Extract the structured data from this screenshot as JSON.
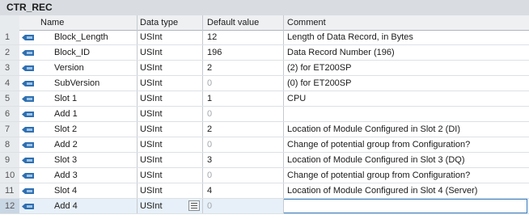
{
  "block": {
    "title": "CTR_REC"
  },
  "columns": {
    "name": "Name",
    "datatype": "Data type",
    "default": "Default value",
    "comment": "Comment"
  },
  "rows": [
    {
      "num": "1",
      "name": "Block_Length",
      "type": "USInt",
      "default": "12",
      "default_muted": false,
      "comment": "Length of Data Record, in Bytes"
    },
    {
      "num": "2",
      "name": "Block_ID",
      "type": "USInt",
      "default": "196",
      "default_muted": false,
      "comment": "Data Record Number (196)"
    },
    {
      "num": "3",
      "name": "Version",
      "type": "USInt",
      "default": "2",
      "default_muted": false,
      "comment": "(2) for ET200SP"
    },
    {
      "num": "4",
      "name": "SubVersion",
      "type": "USInt",
      "default": "0",
      "default_muted": true,
      "comment": "(0) for ET200SP"
    },
    {
      "num": "5",
      "name": "Slot 1",
      "type": "USInt",
      "default": "1",
      "default_muted": false,
      "comment": "CPU"
    },
    {
      "num": "6",
      "name": "Add 1",
      "type": "USInt",
      "default": "0",
      "default_muted": true,
      "comment": ""
    },
    {
      "num": "7",
      "name": "Slot 2",
      "type": "USInt",
      "default": "2",
      "default_muted": false,
      "comment": "Location of Module Configured in Slot 2 (DI)"
    },
    {
      "num": "8",
      "name": "Add 2",
      "type": "USInt",
      "default": "0",
      "default_muted": true,
      "comment": "Change of potential group from Configuration?"
    },
    {
      "num": "9",
      "name": "Slot 3",
      "type": "USInt",
      "default": "3",
      "default_muted": false,
      "comment": "Location of Module Configured in Slot 3 (DQ)"
    },
    {
      "num": "10",
      "name": "Add 3",
      "type": "USInt",
      "default": "0",
      "default_muted": true,
      "comment": "Change of potential group from Configuration?"
    },
    {
      "num": "11",
      "name": "Slot 4",
      "type": "USInt",
      "default": "4",
      "default_muted": false,
      "comment": "Location of Module Configured in Slot 4 (Server)"
    },
    {
      "num": "12",
      "name": "Add 4",
      "type": "USInt",
      "default": "0",
      "default_muted": true,
      "comment": ""
    }
  ],
  "icons": {
    "row_icon": "static-variable-icon",
    "browse": "datatype-browse-icon"
  },
  "colors": {
    "muted_value": "#a3a8ad",
    "accent": "#3c7fc1",
    "icon_blue": "#2f6fb0"
  }
}
